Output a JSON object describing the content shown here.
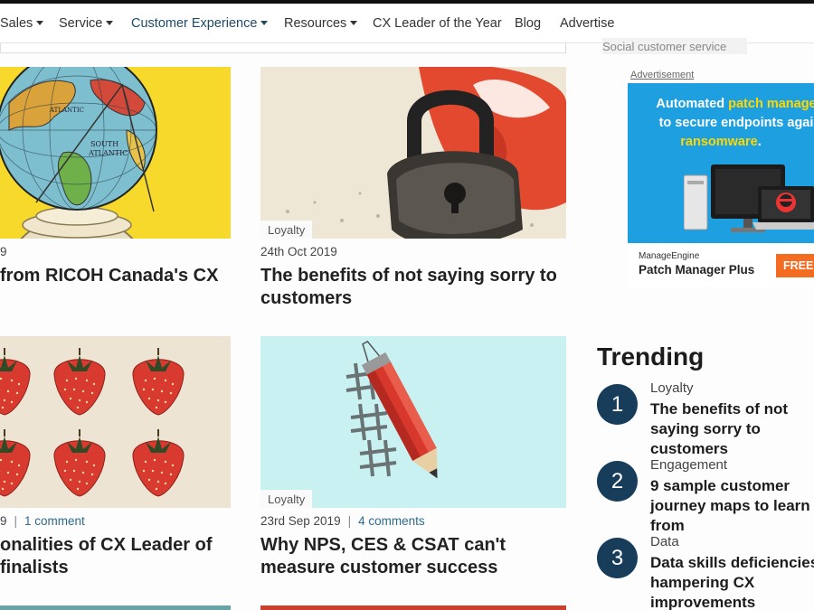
{
  "nav": {
    "items": [
      {
        "label": "Sales",
        "caret": true
      },
      {
        "label": "Service",
        "caret": true
      },
      {
        "label": "Customer Experience",
        "caret": true,
        "active": true
      },
      {
        "label": "Resources",
        "caret": true
      },
      {
        "label": "CX Leader of the Year",
        "caret": false
      },
      {
        "label": "Blog",
        "caret": false
      },
      {
        "label": "Advertise",
        "caret": false
      }
    ],
    "search_tag": "Social customer service"
  },
  "articles": [
    {
      "date": "9",
      "title": "from RICOH Canada's CX",
      "tag": ""
    },
    {
      "date": "24th Oct 2019",
      "title": "The benefits of not saying sorry to customers",
      "tag": "Loyalty"
    },
    {
      "date": "9",
      "comments": "1 comment",
      "title": "onalities of CX Leader of finalists",
      "tag": ""
    },
    {
      "date": "23rd Sep 2019",
      "comments": "4 comments",
      "title": "Why NPS, CES & CSAT can't measure customer success",
      "tag": "Loyalty"
    }
  ],
  "ad": {
    "label": "Advertisement",
    "line1_prefix": "Automated ",
    "line1_highlight": "patch manage",
    "line2": "to secure endpoints agai",
    "line3_highlight": "ransomware",
    "line3_suffix": ".",
    "brand": "ManageEngine",
    "product": "Patch Manager Plus",
    "cta": "FREE"
  },
  "trending": {
    "heading": "Trending",
    "items": [
      {
        "num": "1",
        "category": "Loyalty",
        "title": "The benefits of not saying sorry to customers"
      },
      {
        "num": "2",
        "category": "Engagement",
        "title": "9 sample customer journey maps to learn from"
      },
      {
        "num": "3",
        "category": "Data",
        "title": "Data skills deficiencies hampering CX improvements"
      }
    ]
  },
  "colors": {
    "accent": "#173d5a",
    "link": "#2c6a8f",
    "ad_blue": "#1d9fe0",
    "ad_cta": "#f36c21"
  }
}
